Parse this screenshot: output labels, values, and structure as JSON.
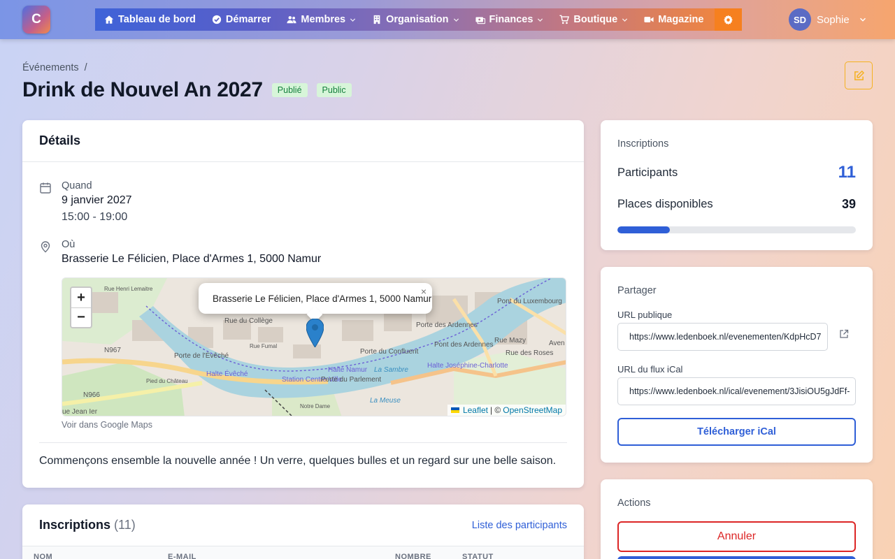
{
  "brand": {
    "logo_letter": "C"
  },
  "nav": {
    "items": [
      {
        "label": "Tableau de bord",
        "icon": "home-icon"
      },
      {
        "label": "Démarrer",
        "icon": "check-circle-icon"
      },
      {
        "label": "Membres",
        "icon": "users-icon",
        "dropdown": true
      },
      {
        "label": "Organisation",
        "icon": "building-icon",
        "dropdown": true
      },
      {
        "label": "Finances",
        "icon": "money-icon",
        "dropdown": true
      },
      {
        "label": "Boutique",
        "icon": "cart-icon",
        "dropdown": true
      },
      {
        "label": "Magazine",
        "icon": "video-icon"
      }
    ],
    "settings_icon": "gear-icon"
  },
  "user": {
    "initials": "SD",
    "name": "Sophie"
  },
  "breadcrumb": {
    "parent": "Événements",
    "separator": "/"
  },
  "event": {
    "title": "Drink de Nouvel An 2027",
    "badges": [
      "Publié",
      "Public"
    ]
  },
  "details": {
    "title": "Détails",
    "when_label": "Quand",
    "date": "9 janvier 2027",
    "time": "15:00 - 19:00",
    "where_label": "Où",
    "address": "Brasserie Le Félicien, Place d'Armes 1, 5000 Namur",
    "map": {
      "popup_text": "Brasserie Le Félicien, Place d'Armes 1, 5000 Namur",
      "popup_close": "×",
      "zoom_in": "+",
      "zoom_out": "−",
      "attribution_leaflet": "Leaflet",
      "attribution_sep": "| ©",
      "attribution_osm": "OpenStreetMap",
      "labels": {
        "rue_du_college": "Rue du Collège",
        "porte_eveche": "Porte de l'Évêché",
        "halte_eveche": "Halte Évêché",
        "station": "Station Centre-Ville",
        "porte_parlement": "Porte du Parlement",
        "porte_confluent": "Porte du Confluent",
        "halte_namur": "Halte Namur",
        "la_sambre": "La Sambre",
        "la_meuse": "La Meuse",
        "porte_ardennes": "Porte des Ardennes",
        "pont_ardennes": "Pont des Ardennes",
        "halte_charlotte": "Halte Joséphine-Charlotte",
        "pont_luxembourg": "Pont du Luxembourg",
        "n967": "N967",
        "n966": "N966",
        "rue_mazy": "Rue Mazy",
        "rue_roses": "Rue des Roses",
        "avenue": "Aven",
        "jean_ier": "ue Jean Ier",
        "rue_haut": "Rue Henri Lemaitre",
        "rue_fumal": "Rue Fumal",
        "notre_dame": "Notre Dame",
        "rue_saintes": "Pied du Château"
      }
    },
    "maps_link": "Voir dans Google Maps",
    "description": "Commençons ensemble la nouvelle année ! Un verre, quelques bulles et un regard sur une belle saison."
  },
  "registrations": {
    "title": "Inscriptions",
    "count": "(11)",
    "list_link": "Liste des participants",
    "columns": [
      "NOM",
      "E-MAIL",
      "NOMBRE",
      "STATUT"
    ]
  },
  "stats": {
    "title": "Inscriptions",
    "participants_label": "Participants",
    "participants_value": "11",
    "places_label": "Places disponibles",
    "places_value": "39",
    "progress_fraction": 0.22
  },
  "share": {
    "title": "Partager",
    "public_url_label": "URL publique",
    "public_url": "https://www.ledenboek.nl/evenementen/KdpHcD7",
    "ical_label": "URL du flux iCal",
    "ical_url": "https://www.ledenboek.nl/ical/evenement/3JisiOU5gJdFf-",
    "download_label": "Télécharger iCal"
  },
  "actions": {
    "title": "Actions",
    "cancel_label": "Annuler"
  },
  "colors": {
    "primary": "#2f5fd7",
    "danger": "#dc2626",
    "accent": "#f5b120",
    "success_bg": "#d7f5d9"
  }
}
